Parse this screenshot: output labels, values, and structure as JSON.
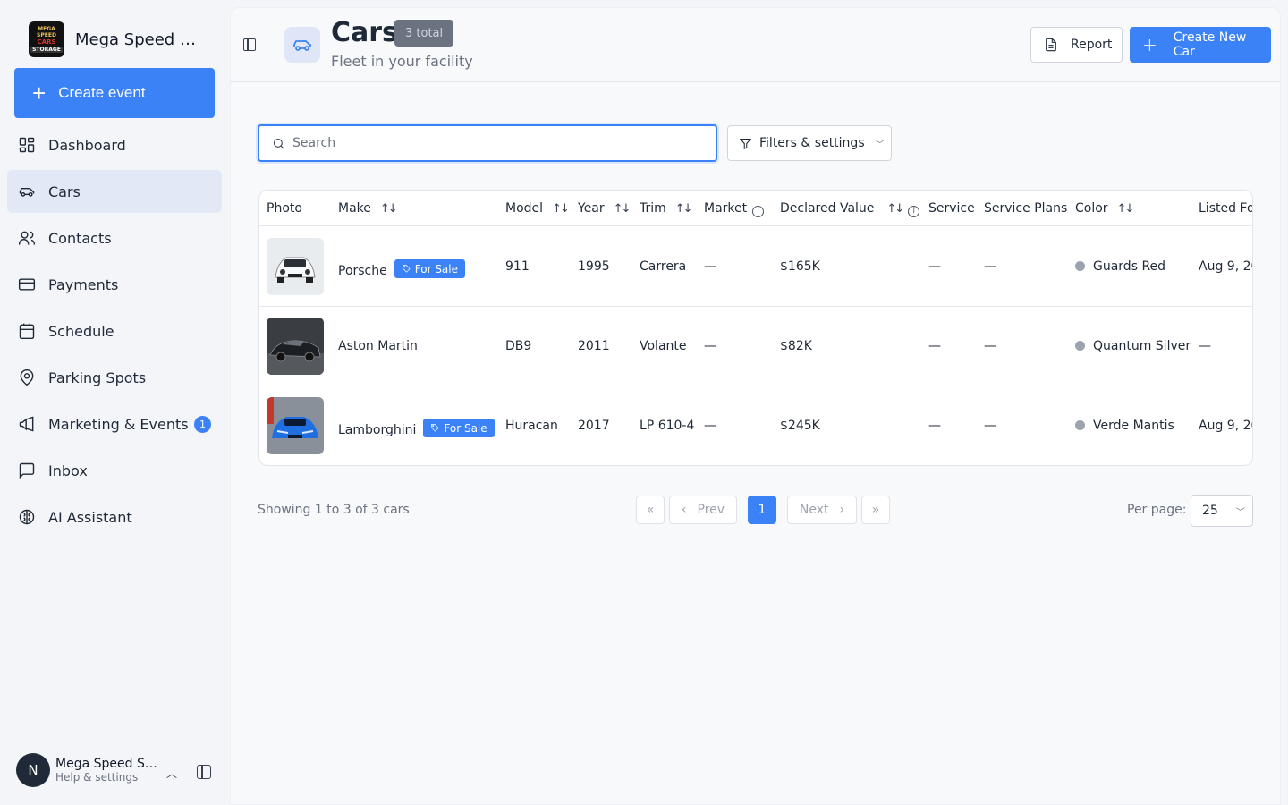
{
  "brand": {
    "name": "Mega Speed St...",
    "logo_text": [
      "MEGA SPEED",
      "CARS",
      "STORAGE"
    ]
  },
  "sidebar": {
    "create_label": "Create event",
    "items": [
      {
        "label": "Dashboard",
        "icon": "dashboard-icon"
      },
      {
        "label": "Cars",
        "icon": "car-icon",
        "active": true
      },
      {
        "label": "Contacts",
        "icon": "contacts-icon"
      },
      {
        "label": "Payments",
        "icon": "credit-card-icon"
      },
      {
        "label": "Schedule",
        "icon": "calendar-icon"
      },
      {
        "label": "Parking Spots",
        "icon": "map-pin-icon"
      },
      {
        "label": "Marketing & Events",
        "icon": "megaphone-icon",
        "badge": "1"
      },
      {
        "label": "Inbox",
        "icon": "message-square-icon"
      },
      {
        "label": "AI Assistant",
        "icon": "brain-icon"
      }
    ]
  },
  "user": {
    "initial": "N",
    "name": "Mega Speed St...",
    "subtitle": "Help & settings"
  },
  "header": {
    "title": "Cars",
    "total_badge": "3 total",
    "subtitle": "Fleet in your facility",
    "report_label": "Report",
    "create_label": "Create New Car"
  },
  "search": {
    "placeholder": "Search",
    "value": ""
  },
  "filters_label": "Filters & settings",
  "table": {
    "columns": [
      "Photo",
      "Make",
      "Model",
      "Year",
      "Trim",
      "Market",
      "Declared Value",
      "Service",
      "Service Plans",
      "Color",
      "Listed Fo"
    ],
    "sale_badge_label": "For Sale",
    "rows": [
      {
        "make": "Porsche",
        "for_sale": true,
        "model": "911",
        "year": "1995",
        "trim": "Carrera",
        "market": "—",
        "declared_value": "$165K",
        "service": "—",
        "service_plans": "—",
        "color": "Guards Red",
        "listed": "Aug 9, 20"
      },
      {
        "make": "Aston Martin",
        "for_sale": false,
        "model": "DB9",
        "year": "2011",
        "trim": "Volante",
        "market": "—",
        "declared_value": "$82K",
        "service": "—",
        "service_plans": "—",
        "color": "Quantum Silver",
        "listed": "—"
      },
      {
        "make": "Lamborghini",
        "for_sale": true,
        "model": "Huracan",
        "year": "2017",
        "trim": "LP 610-4",
        "market": "—",
        "declared_value": "$245K",
        "service": "—",
        "service_plans": "—",
        "color": "Verde Mantis",
        "listed": "Aug 9, 20"
      }
    ]
  },
  "pagination": {
    "showing": "Showing 1 to 3 of 3 cars",
    "first": "«",
    "prev": "Prev",
    "current": "1",
    "next": "Next",
    "last": "»",
    "per_page_label": "Per page:",
    "per_page_value": "25"
  },
  "colors": {
    "accent": "#3b82f6",
    "active_nav": "#e3e8f7",
    "badge_gray": "#6b7280",
    "color_dot": "#9ca3af"
  }
}
